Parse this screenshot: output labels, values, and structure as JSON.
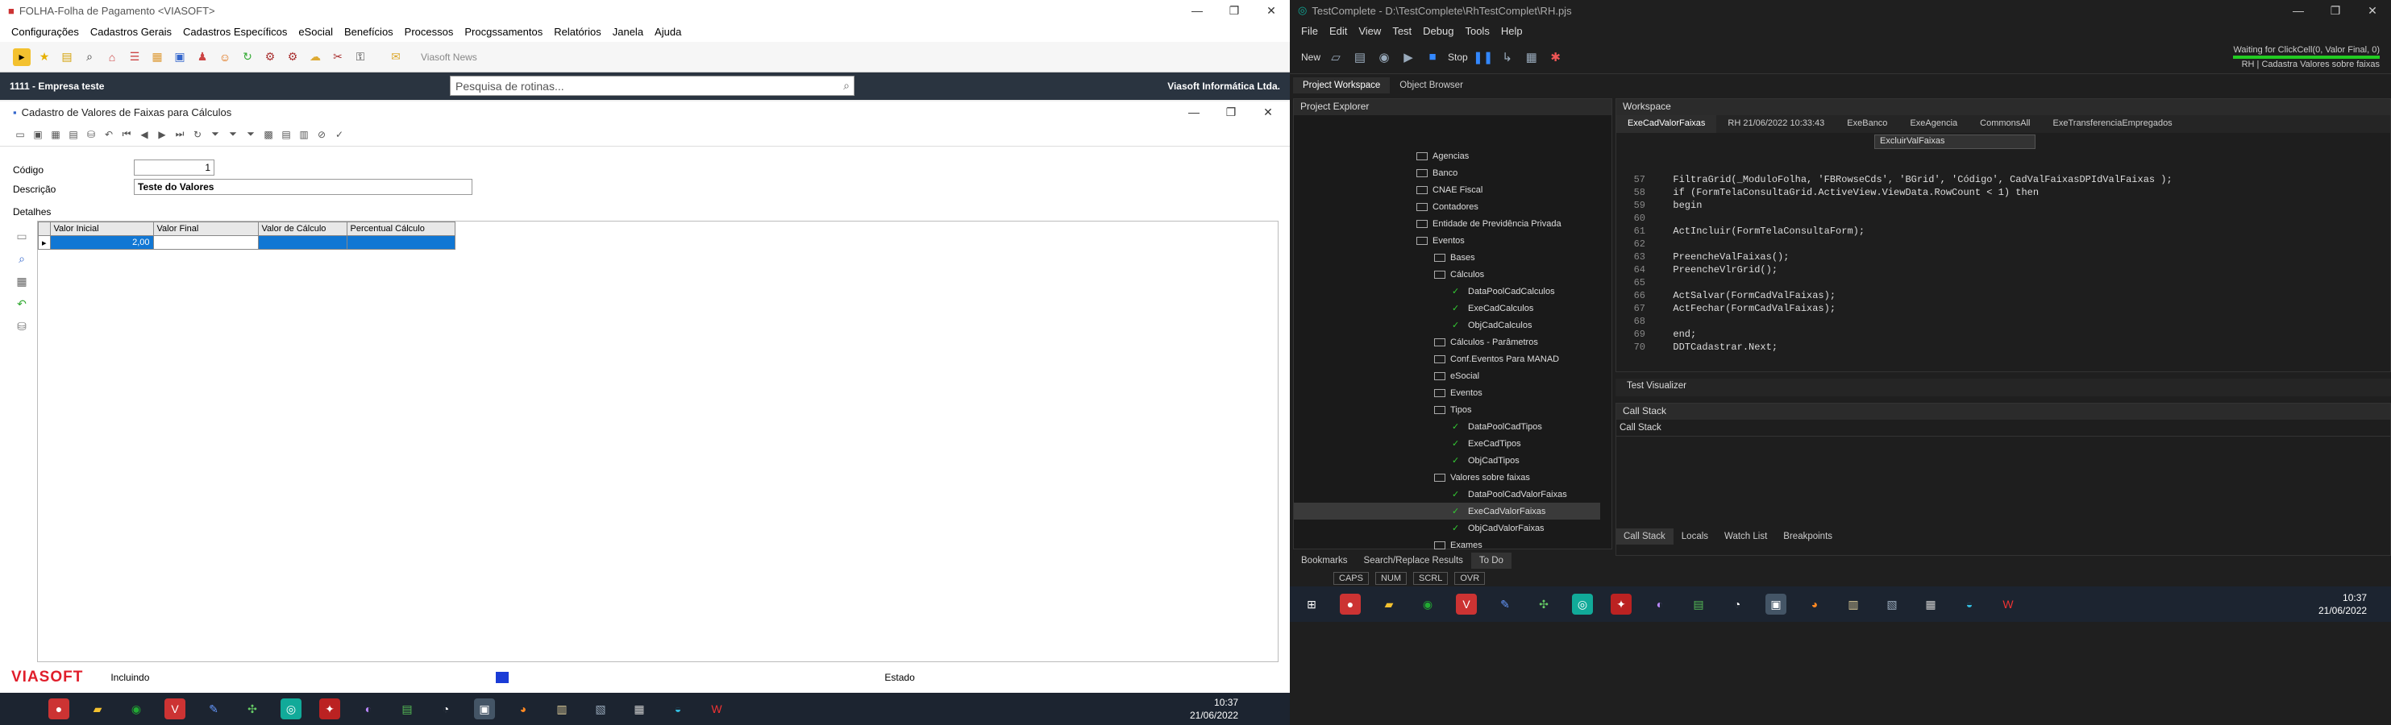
{
  "folha": {
    "title": "FOLHA-Folha de Pagamento <VIASOFT>",
    "menu": [
      "Configurações",
      "Cadastros Gerais",
      "Cadastros Específicos",
      "eSocial",
      "Benefícios",
      "Processos",
      "Procgssamentos",
      "Relatórios",
      "Janela",
      "Ajuda"
    ],
    "news": "Viasoft News",
    "company": "1111 - Empresa teste",
    "search_placeholder": "Pesquisa de rotinas...",
    "vendor": "Viasoft Informática Ltda.",
    "form_title": "Cadastro de Valores de Faixas para Cálculos",
    "codigo_label": "Código",
    "codigo_value": "1",
    "descricao_label": "Descrição",
    "descricao_value": "Teste do Valores",
    "tab": "Detalhes",
    "columns": [
      "Valor Inicial",
      "Valor Final",
      "Valor de Cálculo",
      "Percentual Cálculo"
    ],
    "row": [
      "2,00",
      "",
      "",
      ""
    ],
    "logo": "VIASOFT",
    "status": "Incluindo",
    "estado": "Estado"
  },
  "left_clock": {
    "time": "10:37",
    "date": "21/06/2022"
  },
  "tc": {
    "title": "TestComplete - D:\\TestComplete\\RhTestComplet\\RH.pjs",
    "menu": [
      "File",
      "Edit",
      "View",
      "Test",
      "Debug",
      "Tools",
      "Help"
    ],
    "new_label": "New",
    "stop_label": "Stop",
    "waiting": "Waiting for ClickCell(0, Valor Final, 0)",
    "rh_label": "RH | Cadastra Valores sobre faixas",
    "ws_tabs": [
      "Project Workspace",
      "Object Browser"
    ],
    "pe_title": "Project Explorer",
    "workspace_title": "Workspace",
    "tree": [
      {
        "label": "Agencias",
        "d": 0
      },
      {
        "label": "Banco",
        "d": 0
      },
      {
        "label": "CNAE Fiscal",
        "d": 0
      },
      {
        "label": "Contadores",
        "d": 0
      },
      {
        "label": "Entidade de Previdência Privada",
        "d": 0
      },
      {
        "label": "Eventos",
        "d": 0
      },
      {
        "label": "Bases",
        "d": 1
      },
      {
        "label": "Cálculos",
        "d": 1
      },
      {
        "label": "DataPoolCadCalculos",
        "d": 2
      },
      {
        "label": "ExeCadCalculos",
        "d": 2
      },
      {
        "label": "ObjCadCalculos",
        "d": 2
      },
      {
        "label": "Cálculos - Parâmetros",
        "d": 1
      },
      {
        "label": "Conf.Eventos Para MANAD",
        "d": 1
      },
      {
        "label": "eSocial",
        "d": 1
      },
      {
        "label": "Eventos",
        "d": 1
      },
      {
        "label": "Tipos",
        "d": 1
      },
      {
        "label": "DataPoolCadTipos",
        "d": 2
      },
      {
        "label": "ExeCadTipos",
        "d": 2
      },
      {
        "label": "ObjCadTipos",
        "d": 2
      },
      {
        "label": "Valores sobre faixas",
        "d": 1
      },
      {
        "label": "DataPoolCadValorFaixas",
        "d": 2
      },
      {
        "label": "ExeCadValorFaixas",
        "d": 2
      },
      {
        "label": "ObjCadValorFaixas",
        "d": 2
      },
      {
        "label": "Exames",
        "d": 1
      }
    ],
    "editor_tabs": [
      "ExeCadValorFaixas",
      "RH 21/06/2022 10:33:43",
      "ExeBanco",
      "ExeAgencia",
      "CommonsAll",
      "ExeTransferenciaEmpregados"
    ],
    "routine": "ExcluirValFaixas",
    "code": [
      {
        "n": "57",
        "t": "  FiltraGrid(_ModuloFolha, 'FBRowseCds', 'BGrid', 'Código', CadValFaixasDPIdValFaixas );"
      },
      {
        "n": "58",
        "t": "  if (FormTelaConsultaGrid.ActiveView.ViewData.RowCount < 1) then"
      },
      {
        "n": "59",
        "t": "  begin"
      },
      {
        "n": "60",
        "t": ""
      },
      {
        "n": "61",
        "t": "  ActIncluir(FormTelaConsultaForm);"
      },
      {
        "n": "62",
        "t": ""
      },
      {
        "n": "63",
        "t": "  PreencheValFaixas();"
      },
      {
        "n": "64",
        "t": "  PreencheVlrGrid();"
      },
      {
        "n": "65",
        "t": ""
      },
      {
        "n": "66",
        "t": "  ActSalvar(FormCadValFaixas);"
      },
      {
        "n": "67",
        "t": "  ActFechar(FormCadValFaixas);"
      },
      {
        "n": "68",
        "t": ""
      },
      {
        "n": "69",
        "t": "  end;"
      },
      {
        "n": "70",
        "t": "  DDTCadastrar.Next;"
      }
    ],
    "test_visualizer": "Test Visualizer",
    "call_stack_title": "Call Stack",
    "call_stack_header": "Call Stack",
    "bottom_tabs": [
      "Call Stack",
      "Locals",
      "Watch List",
      "Breakpoints"
    ],
    "panel_tabs": [
      "Bookmarks",
      "Search/Replace Results",
      "To Do"
    ],
    "caps": [
      "CAPS",
      "NUM",
      "SCRL",
      "OVR"
    ],
    "clock": {
      "time": "10:37",
      "date": "21/06/2022"
    }
  }
}
